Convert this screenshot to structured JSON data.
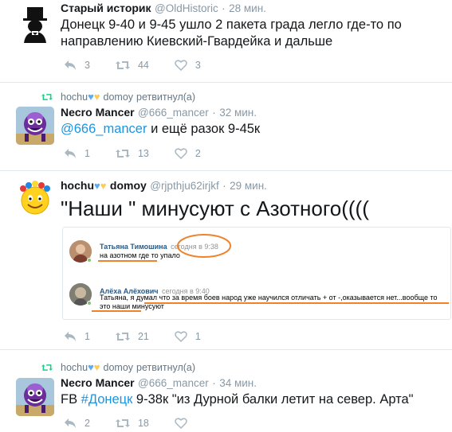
{
  "tweets": [
    {
      "name": "Старый историк",
      "handle": "@OldHistoric",
      "time": "28 мин.",
      "text": "Донецк 9-40 и 9-45 ушло 2 пакета града легло где-то по направлению Киевский-Гвардейка и дальше",
      "replies": "3",
      "retweets": "44",
      "likes": "3"
    },
    {
      "retweeter_name": "hochu",
      "retweeter_name2": "domoy",
      "retweet_label": "ретвитнул(а)",
      "name": "Necro Mancer",
      "handle": "@666_mancer",
      "time": "32 мин.",
      "mention": "@666_mancer",
      "text_rest": " и ещё разок 9-45к",
      "replies": "1",
      "retweets": "13",
      "likes": "2"
    },
    {
      "name": "hochu",
      "name2": "domoy",
      "handle": "@rjpthju62irjkf",
      "time": "29 мин.",
      "text": "\"Наши \" минусуют с Азотного((((",
      "replies": "1",
      "retweets": "21",
      "likes": "1",
      "card": {
        "comment1": {
          "author": "Татьяна Тимошина",
          "time": "сегодня в 9:38",
          "text": "на азотном где то упало"
        },
        "comment2": {
          "author": "Алёха Алёхович",
          "time": "сегодня в 9:40",
          "text": "Татьяна, я думал что за время боев народ уже научился отличать + от -,оказывается нет...вообще то это наши минусуют"
        },
        "highlight_color": "#f0832a"
      }
    },
    {
      "retweeter_name": "hochu",
      "retweeter_name2": "domoy",
      "retweet_label": "ретвитнул(а)",
      "name": "Necro Mancer",
      "handle": "@666_mancer",
      "time": "34 мин.",
      "text_prefix": "FB ",
      "hashtag": "#Донецк",
      "text_rest": " 9-38к \"из Дурной балки летит на север. Арта\"",
      "replies": "2",
      "retweets": "18",
      "likes": ""
    }
  ],
  "separator": "·",
  "colors": {
    "link": "#1b95e0",
    "retweet_green": "#19cf86",
    "muted": "#8899a6"
  },
  "icons": [
    "reply-icon",
    "retweet-icon",
    "heart-icon",
    "blue-heart-emoji",
    "yellow-heart-emoji"
  ]
}
